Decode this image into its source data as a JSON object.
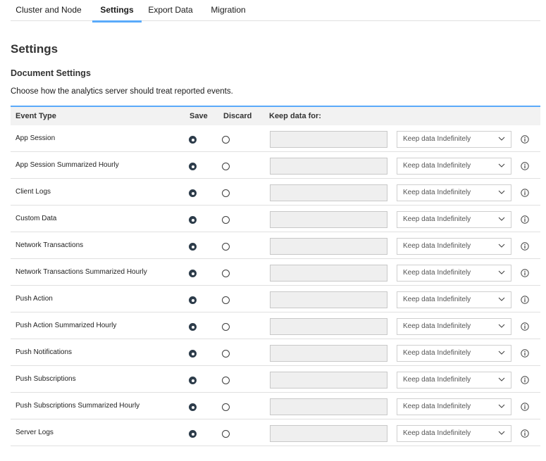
{
  "tabs": [
    {
      "label": "Cluster and Node",
      "active": false
    },
    {
      "label": "Settings",
      "active": true
    },
    {
      "label": "Export Data",
      "active": false
    },
    {
      "label": "Migration",
      "active": false
    }
  ],
  "page_title": "Settings",
  "section_title": "Document Settings",
  "description": "Choose how the analytics server should treat reported events.",
  "table": {
    "headers": {
      "event_type": "Event Type",
      "save": "Save",
      "discard": "Discard",
      "keep": "Keep data for:"
    },
    "rows": [
      {
        "name": "App Session",
        "selected": "save",
        "retention": "Keep data Indefinitely"
      },
      {
        "name": "App Session Summarized Hourly",
        "selected": "save",
        "retention": "Keep data Indefinitely"
      },
      {
        "name": "Client Logs",
        "selected": "save",
        "retention": "Keep data Indefinitely"
      },
      {
        "name": "Custom Data",
        "selected": "save",
        "retention": "Keep data Indefinitely"
      },
      {
        "name": "Network Transactions",
        "selected": "save",
        "retention": "Keep data Indefinitely"
      },
      {
        "name": "Network Transactions Summarized Hourly",
        "selected": "save",
        "retention": "Keep data Indefinitely"
      },
      {
        "name": "Push Action",
        "selected": "save",
        "retention": "Keep data Indefinitely"
      },
      {
        "name": "Push Action Summarized Hourly",
        "selected": "save",
        "retention": "Keep data Indefinitely"
      },
      {
        "name": "Push Notifications",
        "selected": "save",
        "retention": "Keep data Indefinitely"
      },
      {
        "name": "Push Subscriptions",
        "selected": "save",
        "retention": "Keep data Indefinitely"
      },
      {
        "name": "Push Subscriptions Summarized Hourly",
        "selected": "save",
        "retention": "Keep data Indefinitely"
      },
      {
        "name": "Server Logs",
        "selected": "save",
        "retention": "Keep data Indefinitely"
      }
    ]
  },
  "icons": {
    "select_arrow": "chevron-down-icon",
    "row_info": "info-icon"
  },
  "colors": {
    "accent": "#5aaafa",
    "radio_selected": "#2d3c4a",
    "header_bg": "#f2f2f2"
  }
}
